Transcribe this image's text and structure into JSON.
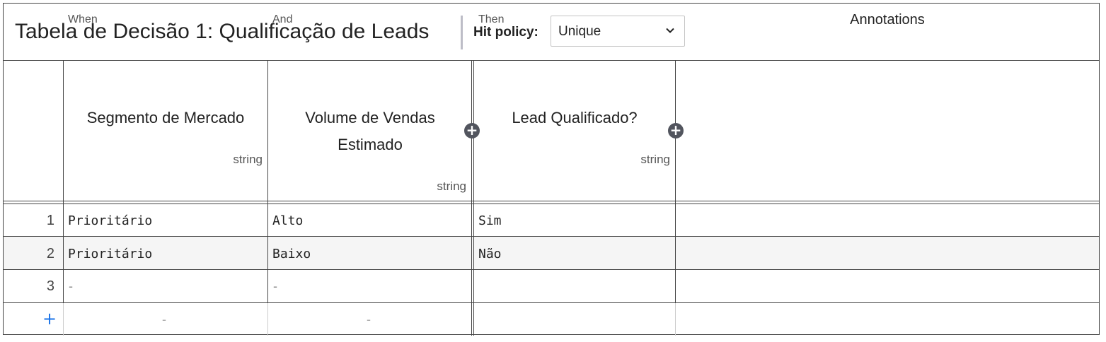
{
  "table": {
    "name": "Tabela de Decisão 1: Qualificação de Leads",
    "hit_policy_label": "Hit policy:",
    "hit_policy_value": "Unique"
  },
  "columns": {
    "input1": {
      "label": "When",
      "name": "Segmento de Mercado",
      "type": "string"
    },
    "input2": {
      "label": "And",
      "name_line1": "Volume de Vendas",
      "name_line2": "Estimado",
      "type": "string"
    },
    "output1": {
      "label": "Then",
      "name": "Lead Qualificado?",
      "type": "string"
    },
    "annotations": "Annotations"
  },
  "add_column_symbol": "+",
  "add_row_symbol": "+",
  "rows": [
    {
      "num": "1",
      "input1": "Prioritário",
      "input2": "Alto",
      "output1": "Sim"
    },
    {
      "num": "2",
      "input1": "Prioritário",
      "input2": "Baixo",
      "output1": "Não"
    },
    {
      "num": "3",
      "input1": "-",
      "input2": "-",
      "output1": ""
    }
  ],
  "add_row": {
    "input1": "-",
    "input2": "-"
  },
  "icons": {
    "dropdown": "chevron-down-icon",
    "add": "plus-icon"
  }
}
